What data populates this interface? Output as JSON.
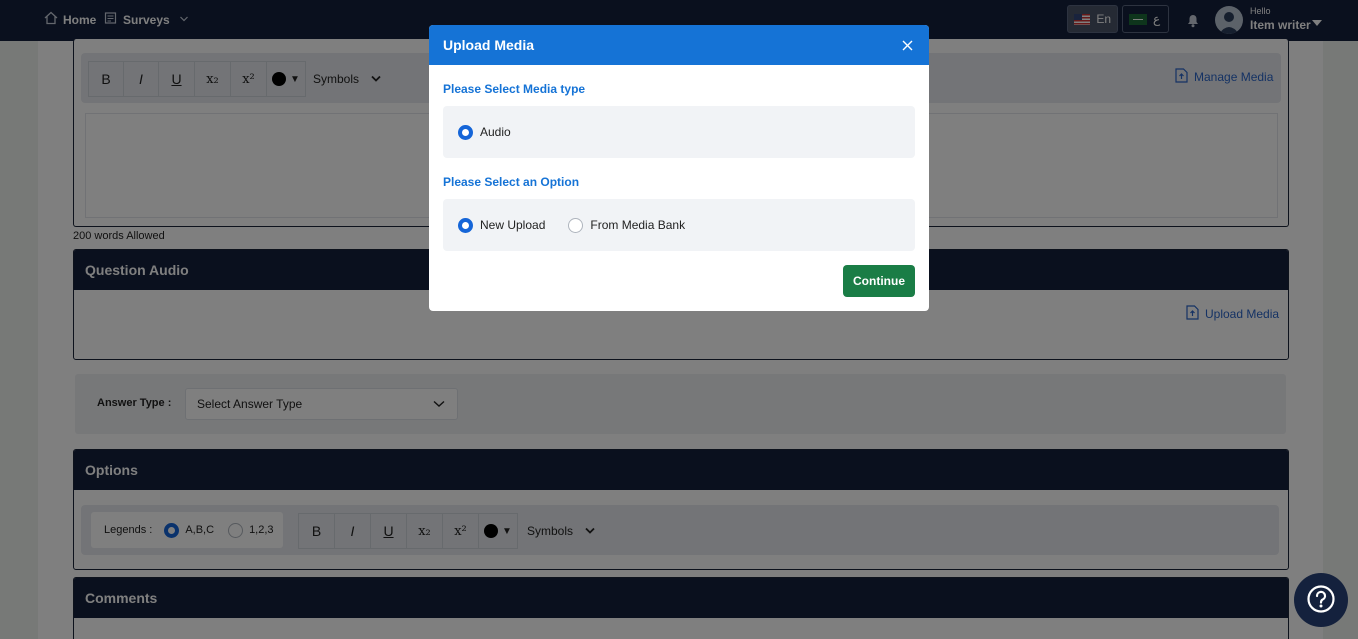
{
  "header": {
    "home_label": "Home",
    "surveys_label": "Surveys",
    "lang_en_label": "En",
    "lang_ar_label": "ع",
    "user_greeting": "Hello",
    "user_name": "Item writer"
  },
  "editor": {
    "bold": "B",
    "italic": "I",
    "underline": "U",
    "subscript": "x₂",
    "superscript": "x²",
    "symbols_label": "Symbols",
    "manage_media_label": "Manage Media",
    "word_limit": "200 words Allowed"
  },
  "question_audio": {
    "title": "Question Audio",
    "upload_media_label": "Upload Media"
  },
  "answer_type": {
    "label": "Answer Type :",
    "selected": "Select Answer Type"
  },
  "options_section": {
    "title": "Options",
    "legends_label": "Legends :",
    "legend_abc": "A,B,C",
    "legend_123": "1,2,3",
    "bold": "B",
    "italic": "I",
    "underline": "U",
    "subscript": "x₂",
    "superscript": "x²",
    "symbols_label": "Symbols"
  },
  "comments": {
    "title": "Comments"
  },
  "modal": {
    "title": "Upload Media",
    "media_type_label": "Please Select Media type",
    "media_type_option": "Audio",
    "option_label": "Please Select an Option",
    "option_new_upload": "New Upload",
    "option_media_bank": "From Media Bank",
    "continue_label": "Continue"
  },
  "colors": {
    "navy": "#14213d",
    "modal_blue": "#1573d6",
    "continue_green": "#1a7d46"
  }
}
